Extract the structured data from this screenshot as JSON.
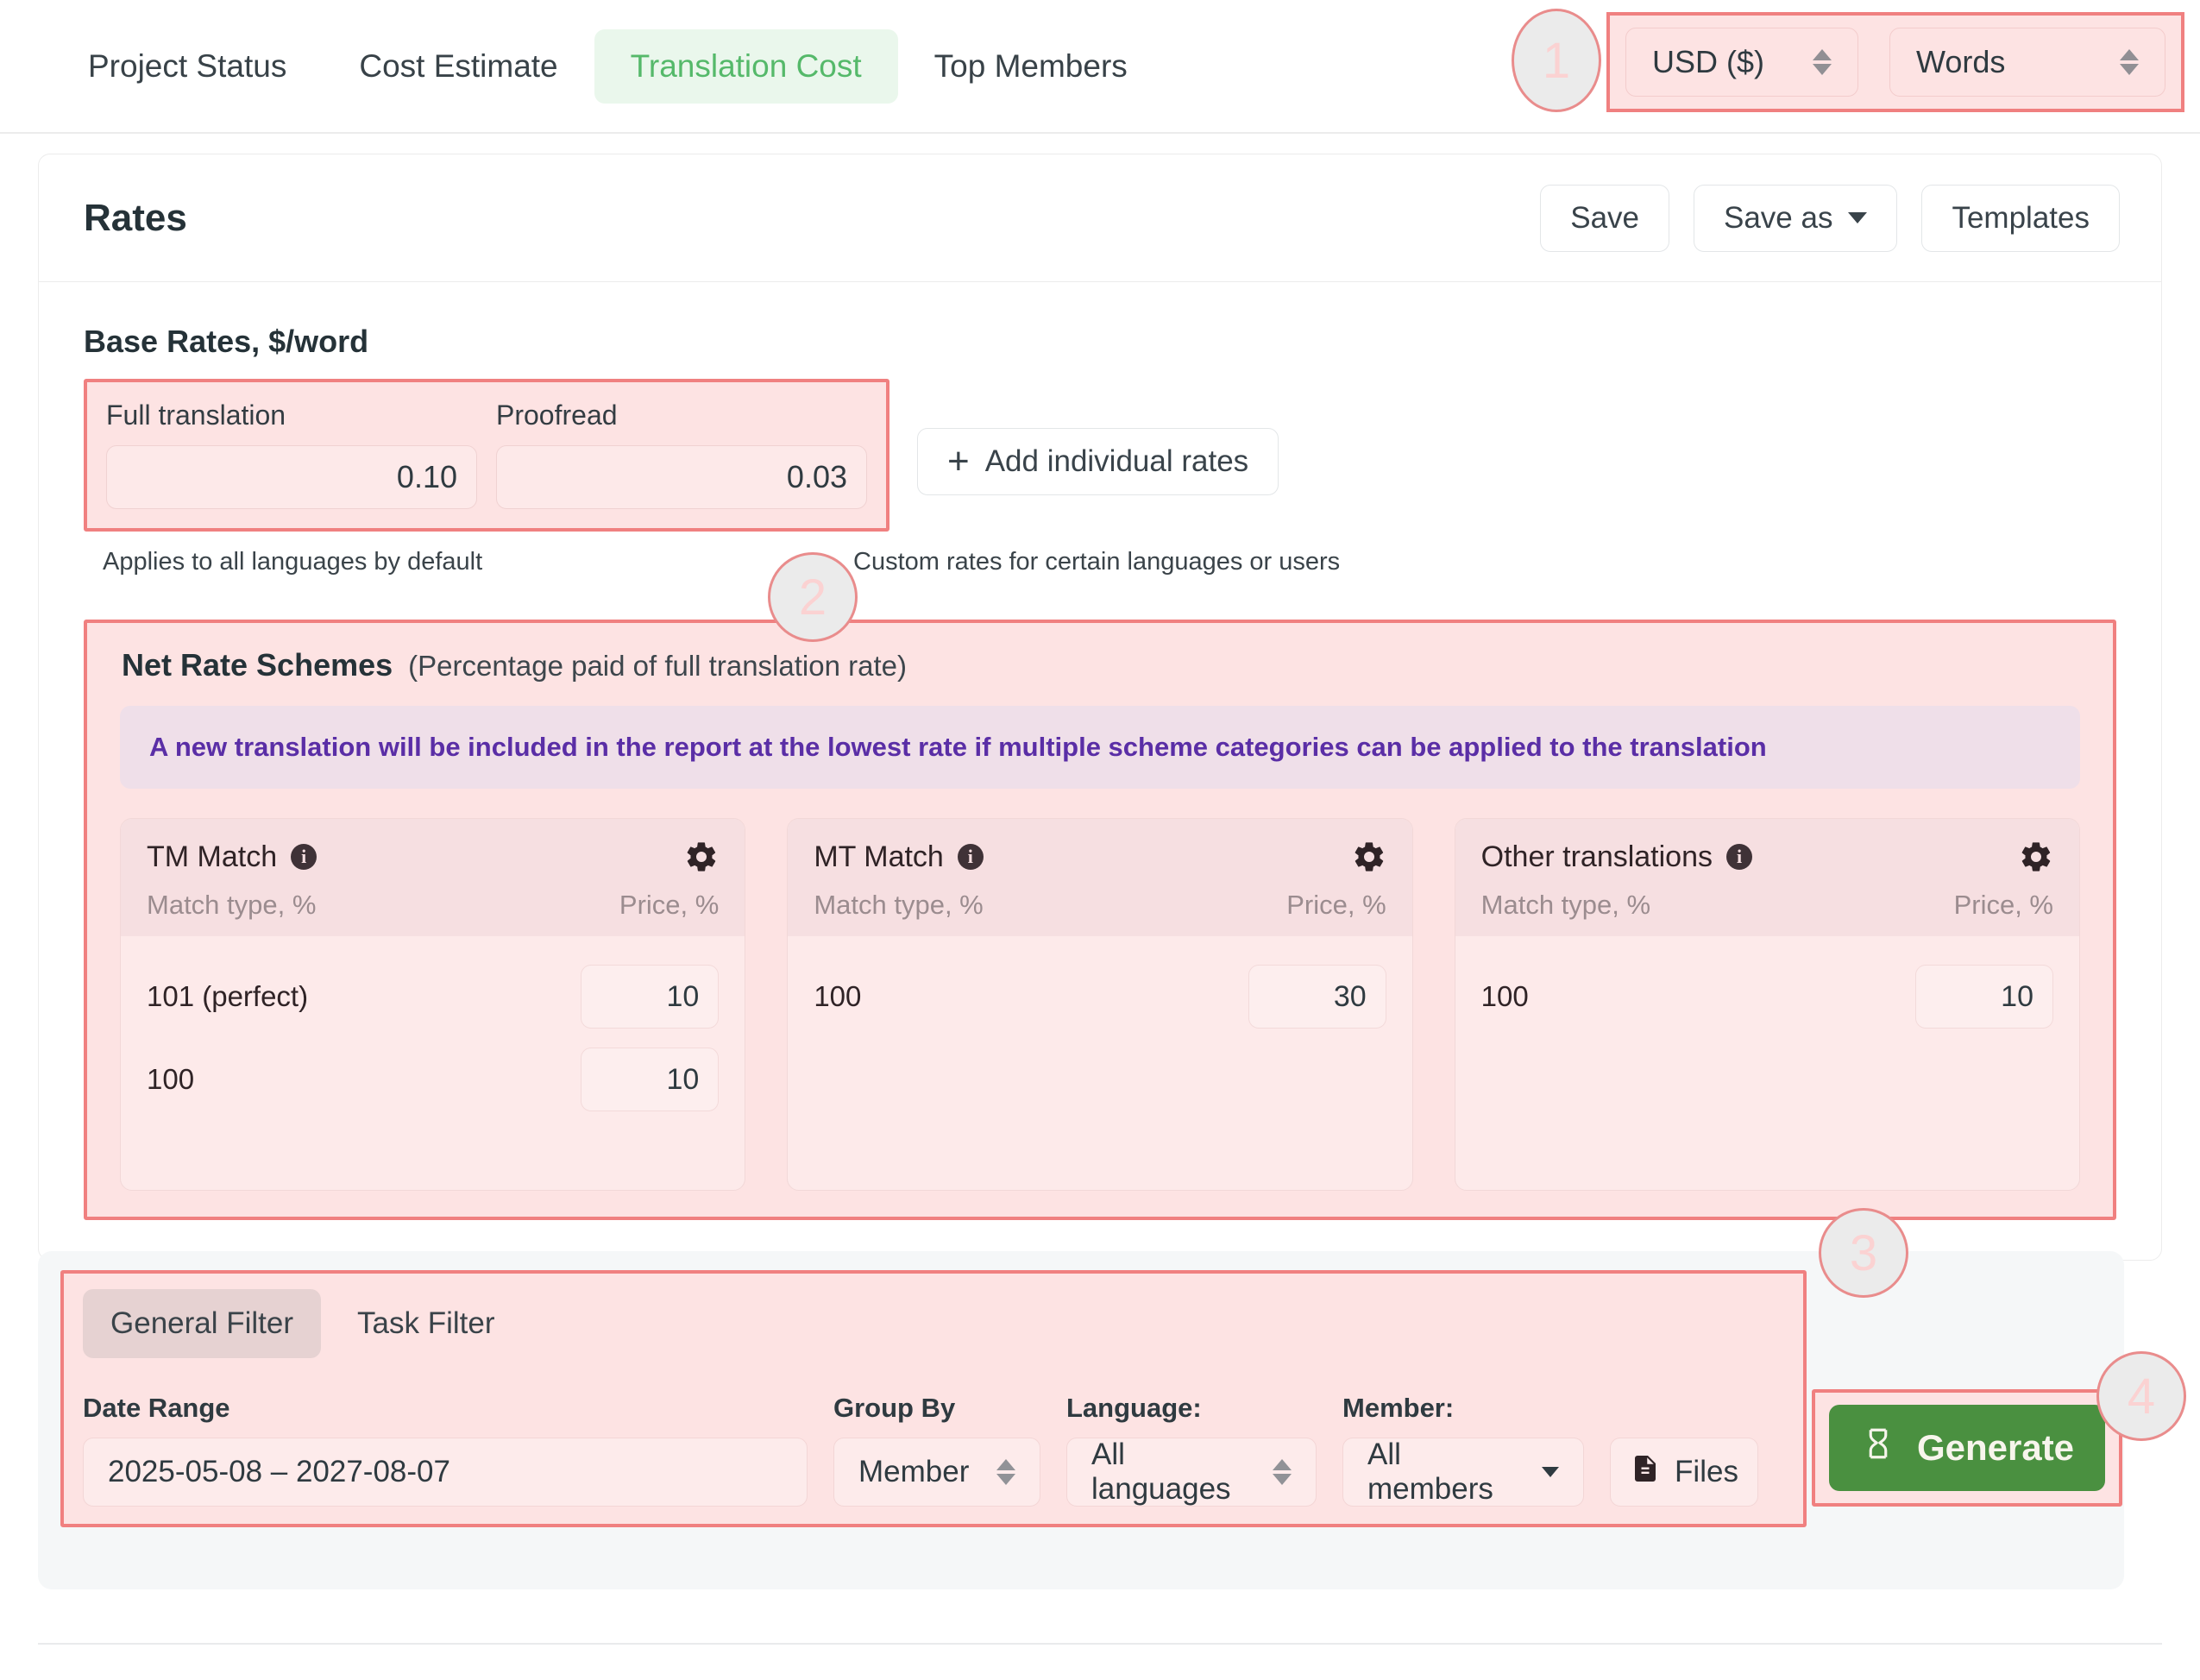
{
  "tabs": [
    {
      "label": "Project Status",
      "active": false
    },
    {
      "label": "Cost Estimate",
      "active": false
    },
    {
      "label": "Translation Cost",
      "active": true
    },
    {
      "label": "Top Members",
      "active": false
    }
  ],
  "topright": {
    "currency": "USD ($)",
    "units": "Words"
  },
  "badges": {
    "one": "1",
    "two": "2",
    "three": "3",
    "four": "4"
  },
  "rates": {
    "title": "Rates",
    "save_label": "Save",
    "save_as_label": "Save as",
    "templates_label": "Templates",
    "base_section_title": "Base Rates, $/word",
    "full_translation_label": "Full translation",
    "full_translation_value": "0.10",
    "proofread_label": "Proofread",
    "proofread_value": "0.03",
    "add_individual_label": "Add individual rates",
    "caption_left": "Applies to all languages by default",
    "caption_right": "Custom rates for certain languages or users"
  },
  "net_rate_schemes": {
    "title": "Net Rate Schemes",
    "subtitle": "(Percentage paid of full translation rate)",
    "note": "A new translation will be included in the report at the lowest rate if multiple scheme categories can be applied to the translation",
    "col_match_type": "Match type, %",
    "col_price": "Price, %",
    "cards": [
      {
        "name": "TM Match",
        "rows": [
          {
            "match": "101 (perfect)",
            "price": "10"
          },
          {
            "match": "100",
            "price": "10"
          }
        ]
      },
      {
        "name": "MT Match",
        "rows": [
          {
            "match": "100",
            "price": "30"
          }
        ]
      },
      {
        "name": "Other translations",
        "rows": [
          {
            "match": "100",
            "price": "10"
          }
        ]
      }
    ]
  },
  "filters": {
    "tabs": [
      {
        "label": "General Filter",
        "active": true
      },
      {
        "label": "Task Filter",
        "active": false
      }
    ],
    "date_range_label": "Date Range",
    "date_range_value": "2025-05-08 – 2027-08-07",
    "group_by_label": "Group By",
    "group_by_value": "Member",
    "language_label": "Language:",
    "language_value": "All languages",
    "member_label": "Member:",
    "member_value": "All members",
    "files_label": "Files"
  },
  "generate": {
    "label": "Generate"
  },
  "colors": {
    "accent_green": "#4a9040",
    "tab_active_green": "#55b96a",
    "highlight_border": "#f08080",
    "highlight_fill": "#fde3e3",
    "note_purple": "#5a2ea6"
  }
}
